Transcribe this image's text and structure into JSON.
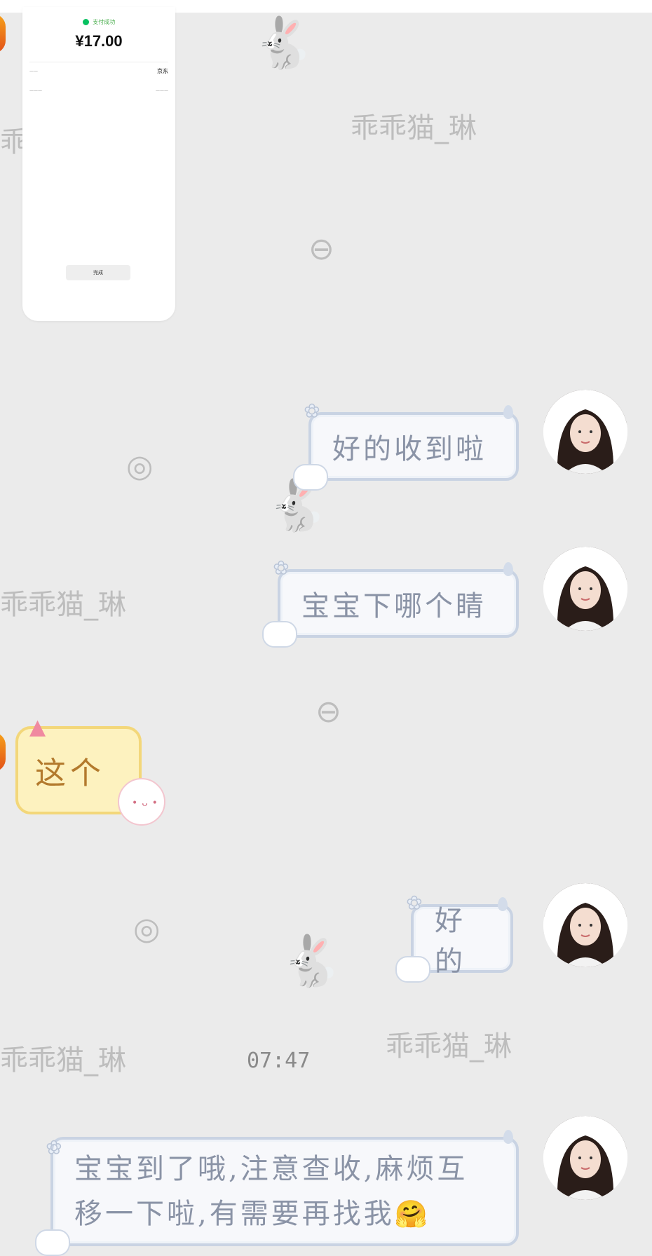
{
  "receipt": {
    "status": "支付成功",
    "amount": "¥17.00",
    "merchant": "京东",
    "done_label": "完成"
  },
  "messages": [
    {
      "id": 1,
      "side": "right",
      "text": "好的收到啦"
    },
    {
      "id": 2,
      "side": "right",
      "text": "宝宝下哪个睛"
    },
    {
      "id": 3,
      "side": "left",
      "text": "这个"
    },
    {
      "id": 4,
      "side": "right",
      "text": "好的"
    },
    {
      "id": 5,
      "side": "right",
      "line1": "宝宝到了哦,注意查收,麻烦互",
      "line2": "移一下啦,有需要再找我",
      "emoji": "🤗"
    }
  ],
  "timestamp": "07:47",
  "watermark": "乖乖猫_琳"
}
